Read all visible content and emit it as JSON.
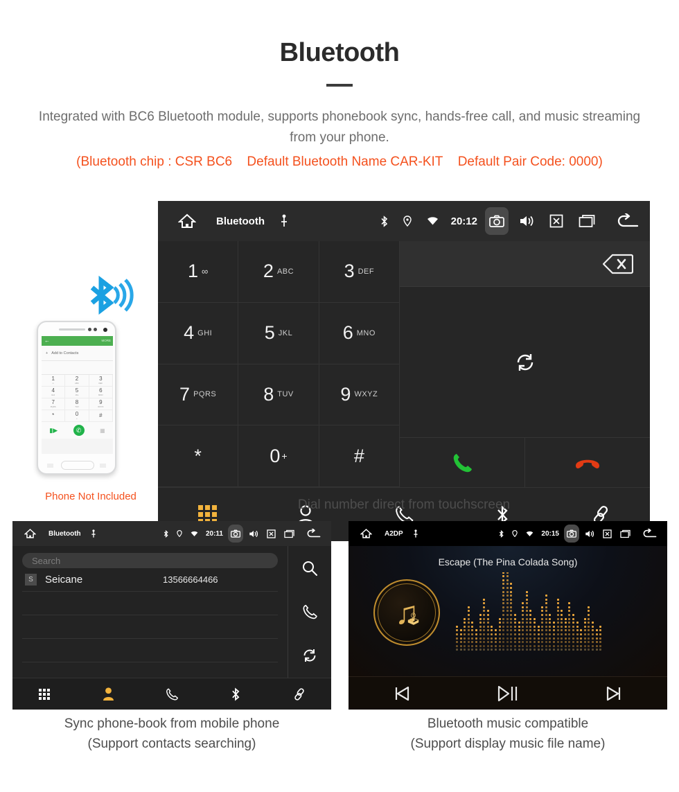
{
  "header": {
    "title": "Bluetooth",
    "intro": "Integrated with BC6 Bluetooth module, supports phonebook sync, hands-free call, and music streaming from your phone.",
    "spec_chip": "(Bluetooth chip : CSR BC6",
    "spec_name": "Default Bluetooth Name CAR-KIT",
    "spec_pair": "Default Pair Code: 0000)"
  },
  "phone_illustration": {
    "caption": "Phone Not Included",
    "screen": {
      "more_label": "MORE",
      "add_to_contacts": "Add to Contacts",
      "keys": [
        {
          "digit": "1",
          "sub": "∞"
        },
        {
          "digit": "2",
          "sub": "ABC"
        },
        {
          "digit": "3",
          "sub": "DEF"
        },
        {
          "digit": "4",
          "sub": "GHI"
        },
        {
          "digit": "5",
          "sub": "JKL"
        },
        {
          "digit": "6",
          "sub": "MNO"
        },
        {
          "digit": "7",
          "sub": "PQRS"
        },
        {
          "digit": "8",
          "sub": "TUV"
        },
        {
          "digit": "9",
          "sub": "WXYZ"
        },
        {
          "digit": "*",
          "sub": ""
        },
        {
          "digit": "0",
          "sub": "+"
        },
        {
          "digit": "#",
          "sub": ""
        }
      ]
    }
  },
  "dialer": {
    "status": {
      "title": "Bluetooth",
      "time": "20:12",
      "icons": [
        "home-icon",
        "usb-icon",
        "bluetooth-icon",
        "location-icon",
        "wifi-icon",
        "camera-icon",
        "volume-icon",
        "close-box-icon",
        "recent-apps-icon",
        "back-icon"
      ]
    },
    "keys": [
      {
        "digit": "1",
        "sub": "",
        "voicemail": true
      },
      {
        "digit": "2",
        "sub": "ABC"
      },
      {
        "digit": "3",
        "sub": "DEF"
      },
      {
        "digit": "4",
        "sub": "GHI"
      },
      {
        "digit": "5",
        "sub": "JKL"
      },
      {
        "digit": "6",
        "sub": "MNO"
      },
      {
        "digit": "7",
        "sub": "PQRS"
      },
      {
        "digit": "8",
        "sub": "TUV"
      },
      {
        "digit": "9",
        "sub": "WXYZ"
      },
      {
        "digit": "*",
        "sub": ""
      },
      {
        "digit": "0",
        "sub": "+"
      },
      {
        "digit": "#",
        "sub": ""
      }
    ],
    "input_value": "",
    "nav": [
      "keypad-icon",
      "contacts-icon",
      "call-log-icon",
      "bluetooth-icon",
      "link-icon"
    ],
    "active_nav": "keypad-icon",
    "accent_color": "#f2b33d",
    "call_color": "#22c236",
    "hangup_color": "#e23b14",
    "caption": "Dial number direct from touchscreen"
  },
  "phonebook": {
    "status": {
      "title": "Bluetooth",
      "time": "20:11"
    },
    "search_placeholder": "Search",
    "contacts": [
      {
        "initial": "S",
        "name": "Seicane",
        "number": "13566664466"
      }
    ],
    "side_actions": [
      "search-icon",
      "call-icon",
      "sync-icon"
    ],
    "nav": [
      "keypad-icon",
      "contacts-icon",
      "call-log-icon",
      "bluetooth-icon",
      "link-icon"
    ],
    "active_nav": "contacts-icon",
    "caption_line1": "Sync phone-book from mobile phone",
    "caption_line2": "(Support contacts searching)"
  },
  "music": {
    "status": {
      "title": "A2DP",
      "time": "20:15"
    },
    "track_title": "Escape (The Pina Colada Song)",
    "controls": [
      "previous-icon",
      "play-pause-icon",
      "next-icon"
    ],
    "accent_color": "#e3b458",
    "caption_line1": "Bluetooth music compatible",
    "caption_line2": "(Support display music file name)"
  }
}
